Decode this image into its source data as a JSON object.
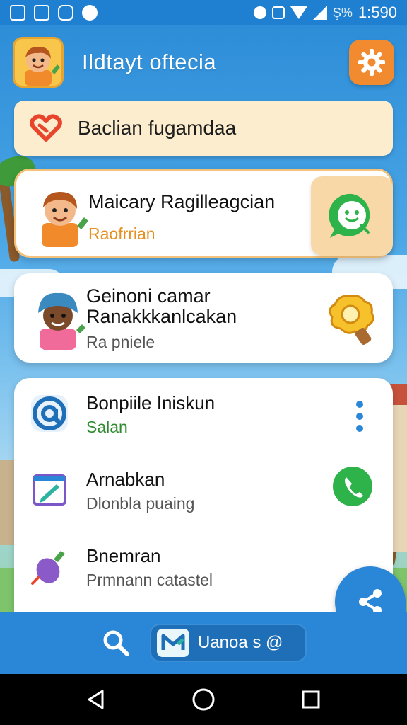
{
  "status_bar": {
    "time": "1:590",
    "battery_text": "Ş%"
  },
  "header": {
    "title": "Ildtayt oftecia"
  },
  "banner": {
    "text": "Baclian fugamdaa"
  },
  "cards": [
    {
      "title": "Maicary Ragilleagcian",
      "subtitle": "Raofrrian"
    },
    {
      "title_line1": "Geinoni camar",
      "title_line2": "Ranakkkanlcakan",
      "subtitle": "Ra pniele"
    }
  ],
  "list_items": [
    {
      "title": "Bonpiile Iniskun",
      "subtitle": "Salan"
    },
    {
      "title": "Arnabkan",
      "subtitle": "Dlonbla puaing"
    },
    {
      "title": "Bnemran",
      "subtitle": "Prmnann catastel"
    }
  ],
  "bottom_bar": {
    "pill_label": "Uanoa s @"
  },
  "colors": {
    "primary": "#2a86d6",
    "accent": "#f28b30",
    "banner": "#fbedcd",
    "green": "#2e8b2e"
  },
  "icons": [
    "gallery-icon",
    "settings-icon",
    "whatsapp-icon",
    "bulb-icon",
    "at-icon",
    "kebab-icon",
    "edit-icon",
    "veggie-icon",
    "share-icon",
    "search-icon",
    "back-icon",
    "home-icon",
    "recents-icon"
  ]
}
